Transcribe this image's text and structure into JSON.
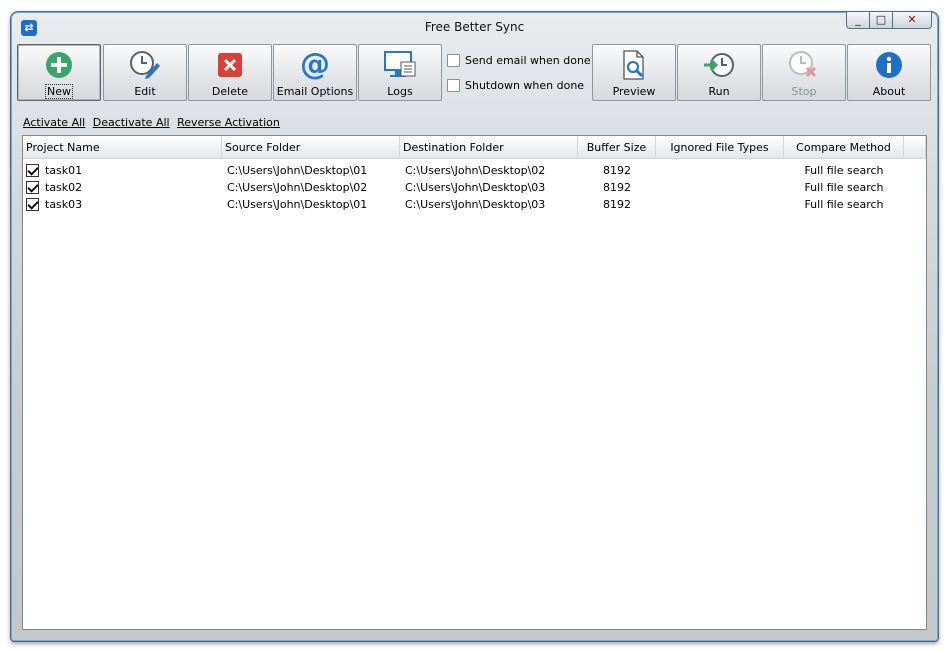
{
  "window": {
    "title": "Free Better Sync",
    "controls": {
      "minimize": "_",
      "maximize": "□",
      "close": "✕"
    }
  },
  "toolbar": {
    "new_label": "New",
    "edit_label": "Edit",
    "delete_label": "Delete",
    "email_options_label": "Email Options",
    "logs_label": "Logs",
    "preview_label": "Preview",
    "run_label": "Run",
    "stop_label": "Stop",
    "about_label": "About"
  },
  "options": {
    "send_email_label": "Send email when done",
    "send_email_checked": false,
    "shutdown_label": "Shutdown when done",
    "shutdown_checked": false
  },
  "links": {
    "activate_all": "Activate All",
    "deactivate_all": "Deactivate All",
    "reverse_activation": "Reverse Activation"
  },
  "table": {
    "columns": [
      "Project Name",
      "Source Folder",
      "Destination Folder",
      "Buffer Size",
      "Ignored File Types",
      "Compare Method"
    ],
    "rows": [
      {
        "checked": true,
        "name": "task01",
        "source": "C:\\Users\\John\\Desktop\\01",
        "destination": "C:\\Users\\John\\Desktop\\02",
        "buffer": "8192",
        "ignored": "",
        "compare": "Full file search"
      },
      {
        "checked": true,
        "name": "task02",
        "source": "C:\\Users\\John\\Desktop\\02",
        "destination": "C:\\Users\\John\\Desktop\\03",
        "buffer": "8192",
        "ignored": "",
        "compare": "Full file search"
      },
      {
        "checked": true,
        "name": "task03",
        "source": "C:\\Users\\John\\Desktop\\01",
        "destination": "C:\\Users\\John\\Desktop\\03",
        "buffer": "8192",
        "ignored": "",
        "compare": "Full file search"
      }
    ]
  },
  "colors": {
    "accent_green": "#3aa56a",
    "delete_red": "#d9403a",
    "email_blue": "#2679c8",
    "about_blue": "#1f6fc4",
    "frame_blue": "#3c6f93"
  }
}
